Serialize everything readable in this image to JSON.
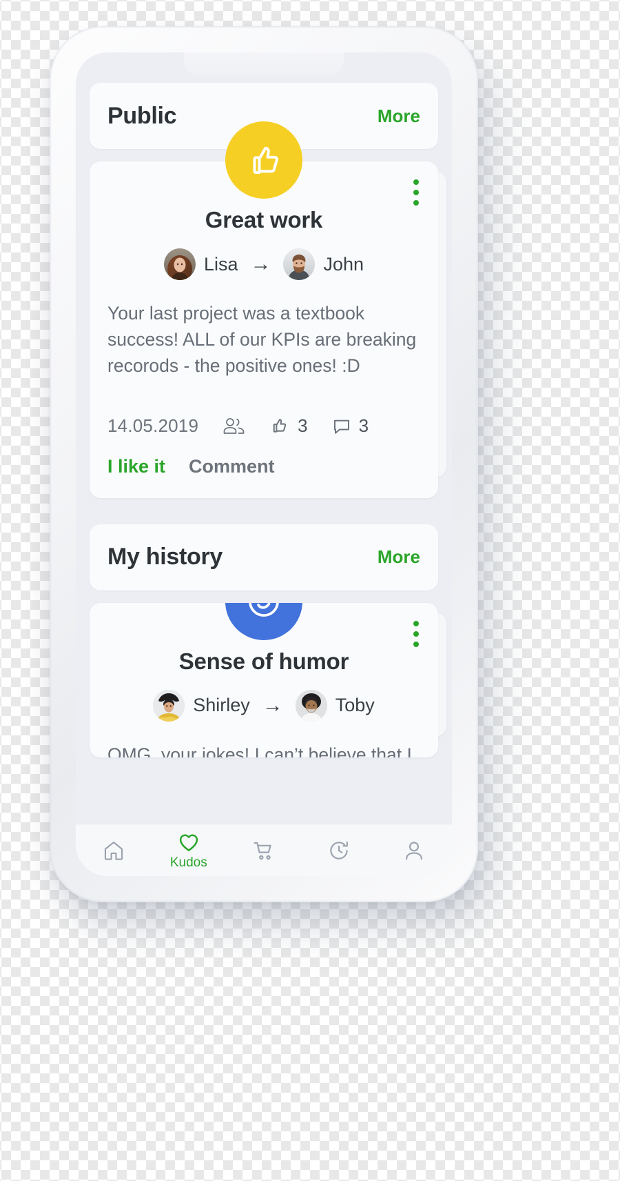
{
  "sections": [
    {
      "title": "Public",
      "more_label": "More",
      "card": {
        "badge_icon": "thumbs-up-icon",
        "badge_color": "#f6cf24",
        "title": "Great work",
        "from_name": "Lisa",
        "to_name": "John",
        "arrow": "→",
        "message": "Your last project was a textbook success! ALL of our KPIs are breaking recorods - the positive ones! :D",
        "date": "14.05.2019",
        "audience_icon": "people-icon",
        "likes_icon": "thumbs-up-outline-icon",
        "likes_count": "3",
        "comments_icon": "comment-bubble-icon",
        "comments_count": "3",
        "like_action_label": "I like it",
        "comment_action_label": "Comment",
        "menu_icon": "kebab-menu-icon"
      }
    },
    {
      "title": "My history",
      "more_label": "More",
      "card": {
        "badge_icon": "smiley-face-icon",
        "badge_color": "#4272db",
        "title": "Sense of humor",
        "from_name": "Shirley",
        "to_name": "Toby",
        "arrow": "→",
        "message": "OMG, your jokes! I can’t believe that I",
        "menu_icon": "kebab-menu-icon"
      }
    }
  ],
  "tab_bar": {
    "items": [
      {
        "icon": "home-icon",
        "label": "",
        "active": false
      },
      {
        "icon": "heart-icon",
        "label": "Kudos",
        "active": true
      },
      {
        "icon": "cart-icon",
        "label": "",
        "active": false
      },
      {
        "icon": "history-icon",
        "label": "",
        "active": false
      },
      {
        "icon": "person-icon",
        "label": "",
        "active": false
      }
    ],
    "active_color": "#2aa52a",
    "inactive_color": "#9aa2ad"
  },
  "theme": {
    "accent_green": "#2aa52a",
    "badge_yellow": "#f6cf24",
    "badge_blue": "#4272db",
    "screen_bg": "#eceef3",
    "card_bg": "#fafbfc"
  }
}
